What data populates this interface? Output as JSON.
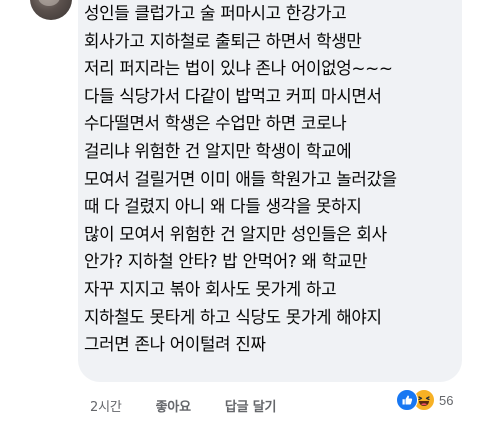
{
  "comment": {
    "lines": [
      "성인들 클럽가고 술 퍼마시고 한강가고",
      "회사가고 지하철로 출퇴근 하면서 학생만",
      "저리 퍼지라는 법이 있냐 존나 어이없엉~~~",
      "다들 식당가서 다같이 밥먹고 커피 마시면서",
      "수다떨면서 학생은 수업만 하면 코로나",
      "걸리냐 위험한 건 알지만 학생이 학교에",
      "모여서 걸릴거면 이미 애들 학원가고 놀러갔을",
      "때 다 걸렸지 아니 왜 다들 생각을 못하지",
      "많이 모여서 위험한 건 알지만 성인들은 회사",
      "안가? 지하철 안타? 밥 안먹어? 왜 학교만",
      "자꾸 지지고 볶아 회사도 못가게 하고",
      "지하철도 못타게 하고 식당도 못가게 해야지",
      "그러면 존나 어이털려 진짜"
    ]
  },
  "actions": {
    "time": "2시간",
    "like_label": "좋아요",
    "reply_label": "답글 달기"
  },
  "reactions": {
    "types": [
      "like-icon",
      "haha-icon"
    ],
    "count": "56",
    "colors": {
      "like": "#1877f2",
      "haha": "#f7b125"
    }
  }
}
